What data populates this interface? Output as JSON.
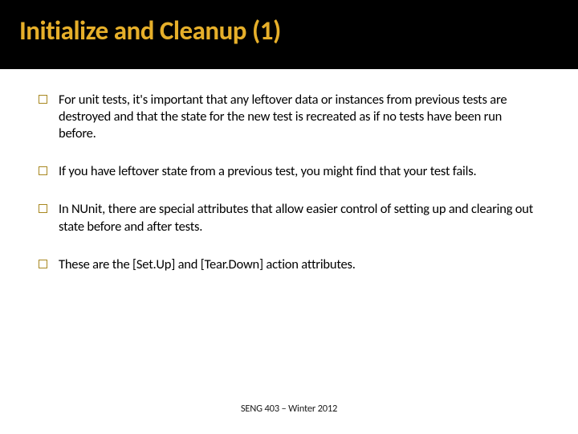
{
  "title": "Initialize and Cleanup (1)",
  "bullets": [
    "For unit tests, it's important that any leftover data or instances from previous tests are destroyed and that the state for the new test is recreated as if no tests have been run before.",
    "If you have leftover state from a previous test, you might find that your test fails.",
    "In NUnit, there are special attributes that allow easier control of setting up and clearing out state before and after tests.",
    "These are the [Set.Up] and [Tear.Down] action attributes."
  ],
  "footer": "SENG 403 – Winter 2012"
}
